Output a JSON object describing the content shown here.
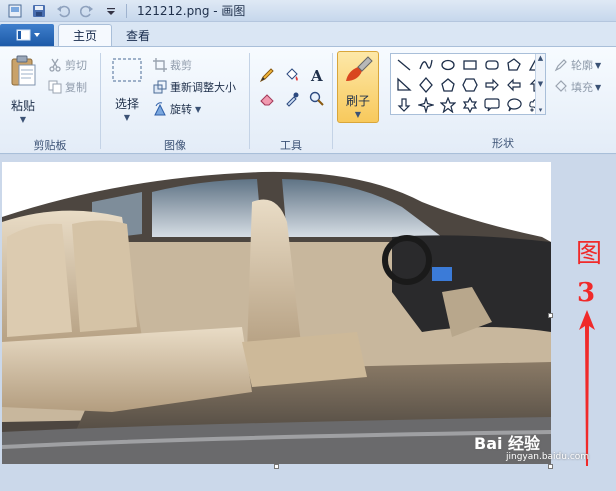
{
  "window": {
    "title": "121212.png - 画图"
  },
  "tabs": [
    {
      "label": "主页",
      "active": true
    },
    {
      "label": "查看",
      "active": false
    }
  ],
  "clipboard": {
    "label": "剪贴板",
    "paste": "粘贴",
    "cut": "剪切",
    "copy": "复制"
  },
  "image": {
    "label": "图像",
    "select": "选择",
    "crop": "裁剪",
    "resize": "重新调整大小",
    "rotate": "旋转"
  },
  "tools": {
    "label": "工具"
  },
  "brushes": {
    "label": "刷子"
  },
  "shapes": {
    "label": "形状",
    "outline": "轮廓",
    "fill": "填充"
  },
  "annotation": {
    "text": "图",
    "number": "3",
    "color": "#f02a2a"
  },
  "watermark": {
    "main": "Bai 经验",
    "sub": "jingyan.baidu.com"
  },
  "colors": {
    "accent": "#1d5aa8",
    "brush_highlight": "#f8c95c"
  }
}
